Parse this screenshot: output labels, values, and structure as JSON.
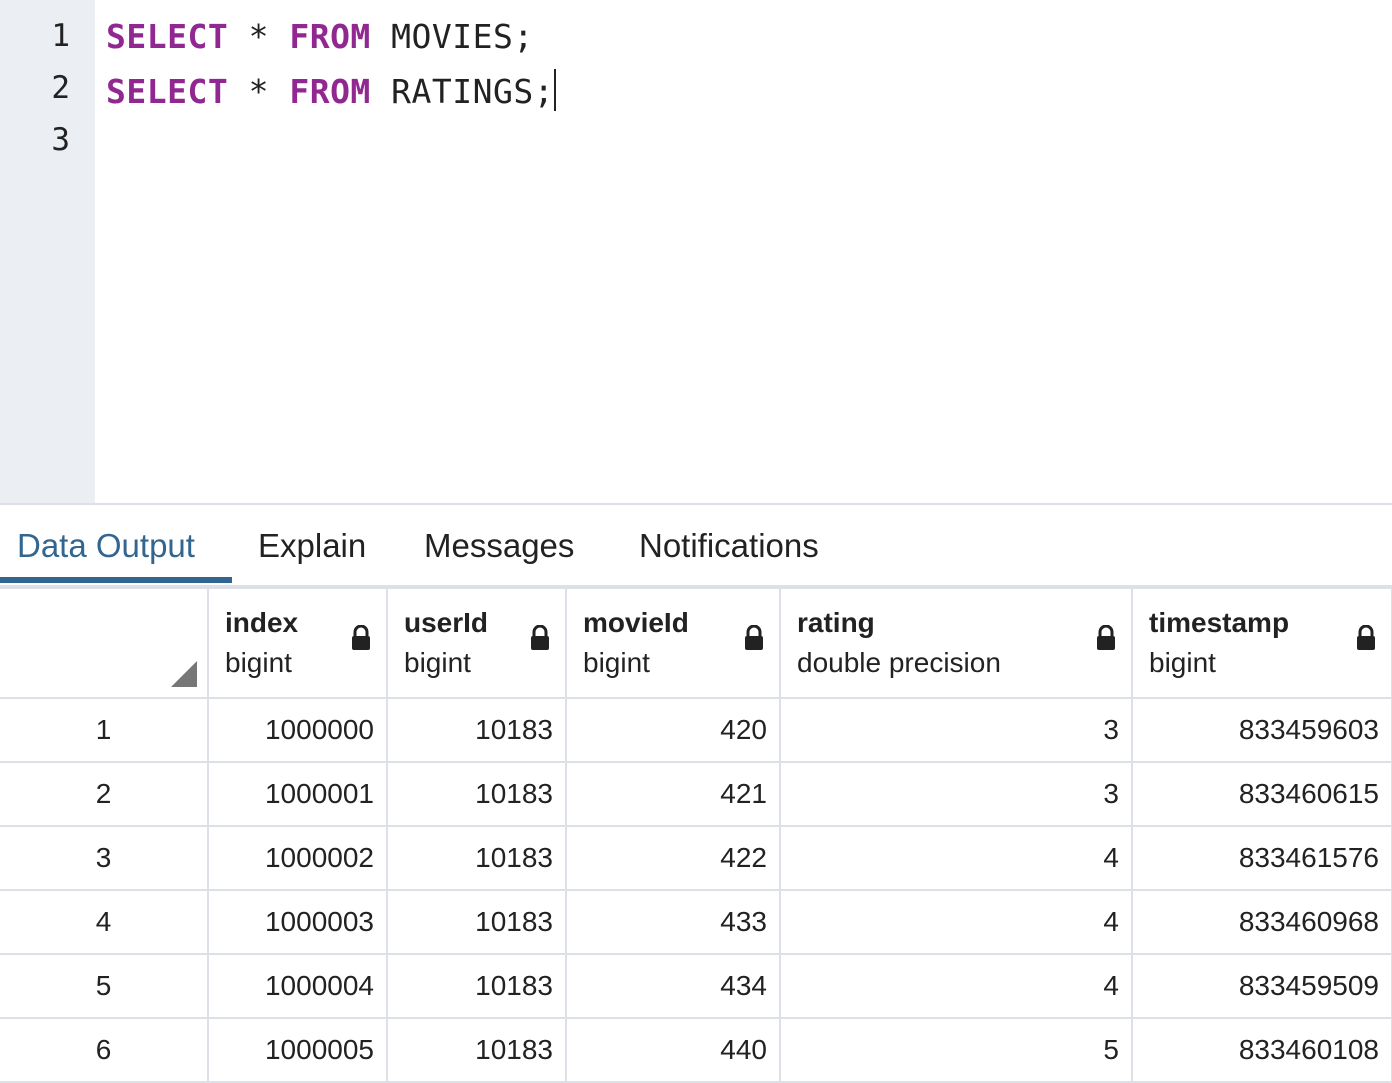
{
  "editor": {
    "line_numbers": [
      "1",
      "2",
      "3"
    ],
    "lines": [
      {
        "kw1": "SELECT",
        "op": " * ",
        "kw2": "FROM",
        "rest": " MOVIES;"
      },
      {
        "kw1": "SELECT",
        "op": " * ",
        "kw2": "FROM",
        "rest": " RATINGS;"
      }
    ]
  },
  "tabs": [
    "Data Output",
    "Explain",
    "Messages",
    "Notifications"
  ],
  "columns": [
    {
      "name": "index",
      "type": "bigint"
    },
    {
      "name": "userId",
      "type": "bigint"
    },
    {
      "name": "movieId",
      "type": "bigint"
    },
    {
      "name": "rating",
      "type": "double precision"
    },
    {
      "name": "timestamp",
      "type": "bigint"
    }
  ],
  "rows": [
    [
      "1",
      "1000000",
      "10183",
      "420",
      "3",
      "833459603"
    ],
    [
      "2",
      "1000001",
      "10183",
      "421",
      "3",
      "833460615"
    ],
    [
      "3",
      "1000002",
      "10183",
      "422",
      "4",
      "833461576"
    ],
    [
      "4",
      "1000003",
      "10183",
      "433",
      "4",
      "833460968"
    ],
    [
      "5",
      "1000004",
      "10183",
      "434",
      "4",
      "833459509"
    ],
    [
      "6",
      "1000005",
      "10183",
      "440",
      "5",
      "833460108"
    ]
  ]
}
